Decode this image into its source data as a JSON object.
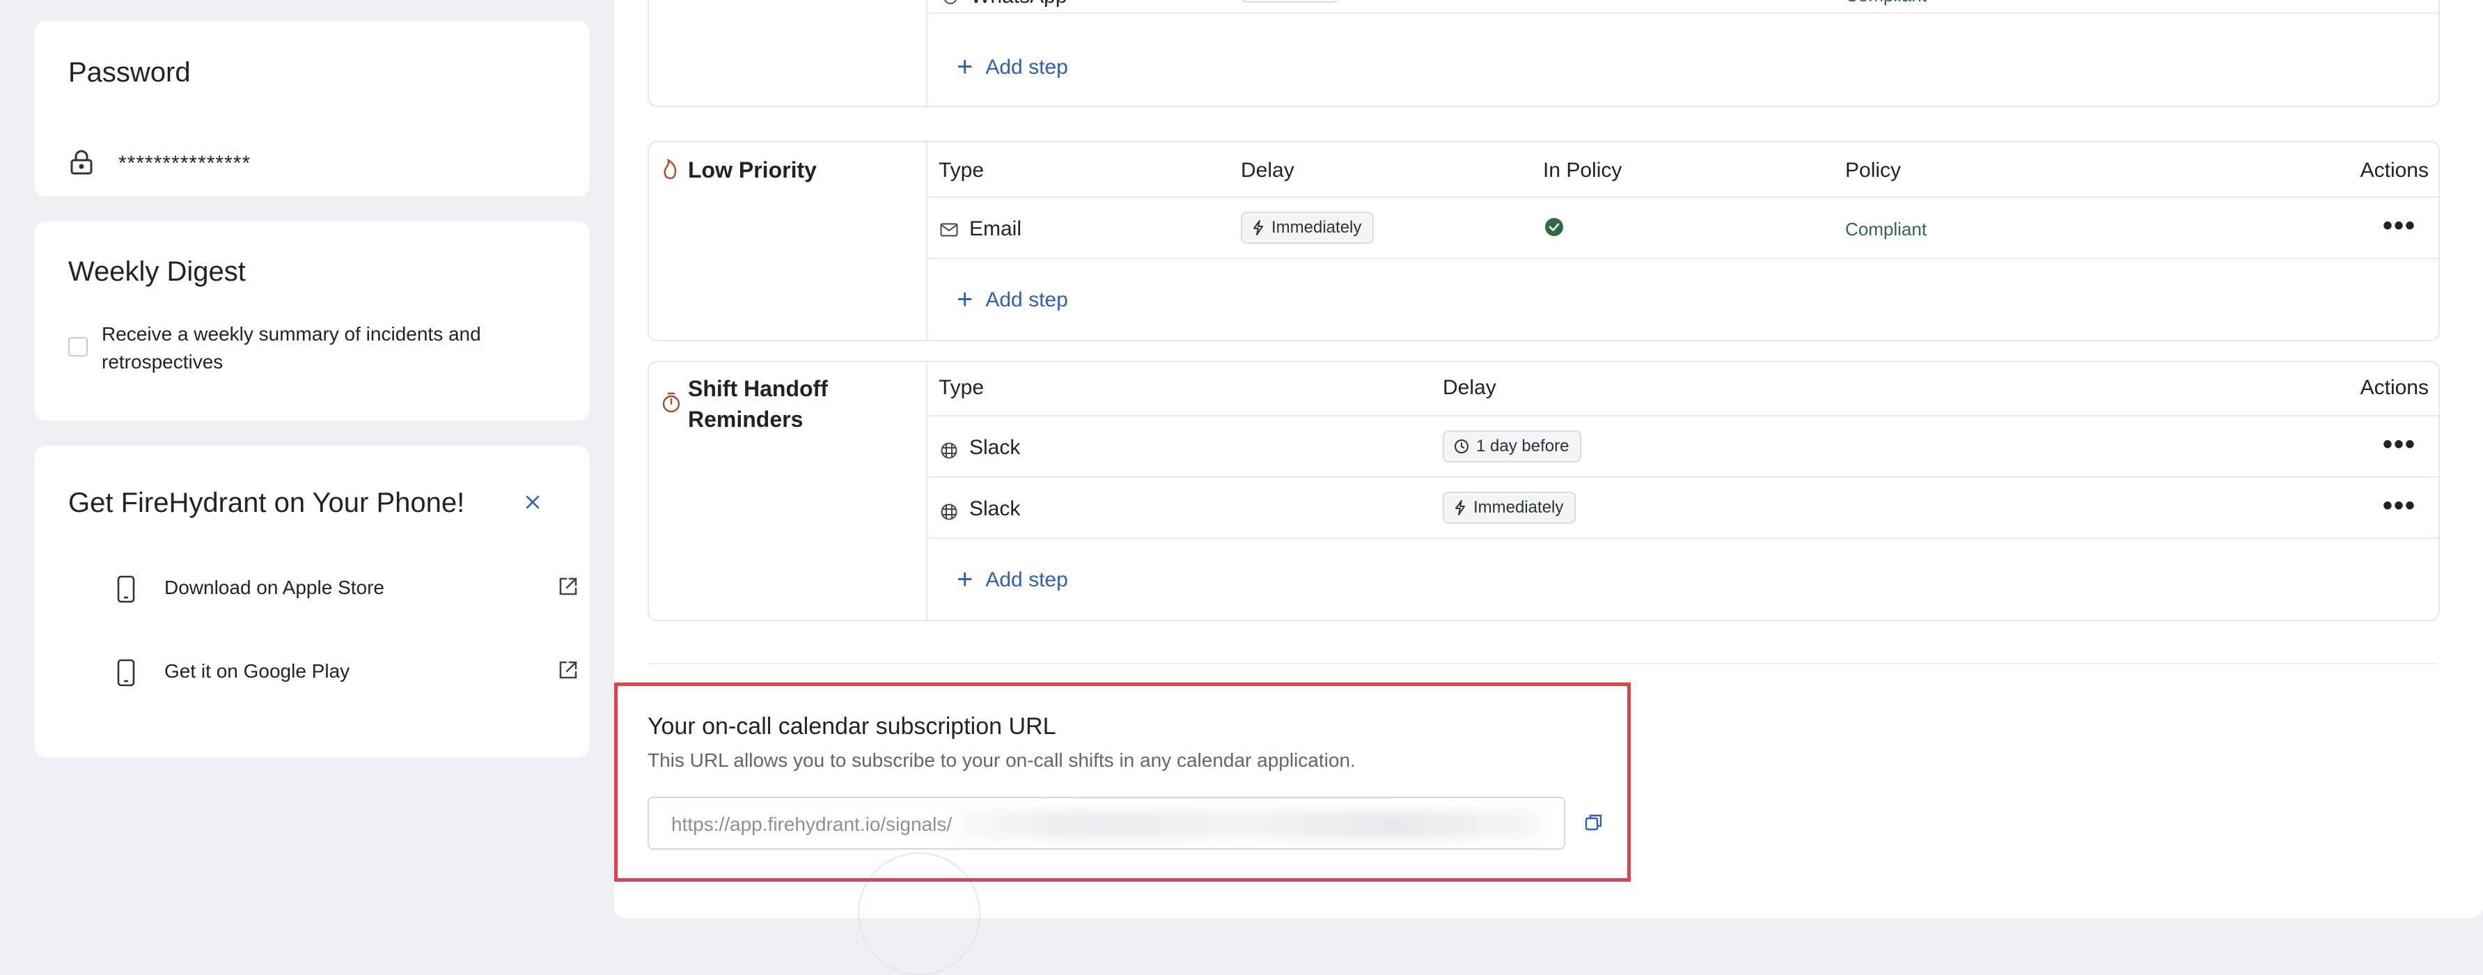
{
  "sidebar": {
    "password": {
      "title": "Password",
      "value": "***************"
    },
    "weekly_digest": {
      "title": "Weekly Digest",
      "checkbox_label_line1": "Receive a weekly summary of incidents and",
      "checkbox_label_line2": "retrospectives",
      "checked": false
    },
    "phone": {
      "title": "Get FireHydrant on Your Phone!",
      "items": [
        {
          "label": "Download on Apple Store",
          "icon": "phone-icon",
          "action_icon": "external-link-icon"
        },
        {
          "label": "Get it on Google Play",
          "icon": "phone-icon",
          "action_icon": "external-link-icon"
        }
      ]
    }
  },
  "policies": {
    "top_block": {
      "partial_type": "WhatsApp",
      "partial_policy": "Compliant",
      "add_step": "Add step"
    },
    "low_priority": {
      "title": "Low Priority",
      "headers": {
        "type": "Type",
        "delay": "Delay",
        "in_policy": "In Policy",
        "policy": "Policy",
        "actions": "Actions"
      },
      "rows": [
        {
          "type": "Email",
          "delay": "Immediately",
          "in_policy": true,
          "policy": "Compliant"
        }
      ],
      "add_step": "Add step"
    },
    "shift_handoff": {
      "title_line1": "Shift Handoff",
      "title_line2": "Reminders",
      "headers": {
        "type": "Type",
        "delay": "Delay",
        "actions": "Actions"
      },
      "rows": [
        {
          "type": "Slack",
          "delay": "1 day before"
        },
        {
          "type": "Slack",
          "delay": "Immediately"
        }
      ],
      "add_step": "Add step"
    }
  },
  "calendar": {
    "title": "Your on-call calendar subscription URL",
    "description": "This URL allows you to subscribe to your on-call shifts in any calendar application.",
    "url_visible": "https://app.firehydrant.io/signals/",
    "copy_icon": "copy-icon"
  },
  "colors": {
    "accent": "#2f5fb3",
    "compliant": "#2f6b3f",
    "check": "#2f6b3f",
    "highlight": "#e0424a",
    "page_bg": "#eef0f4"
  }
}
